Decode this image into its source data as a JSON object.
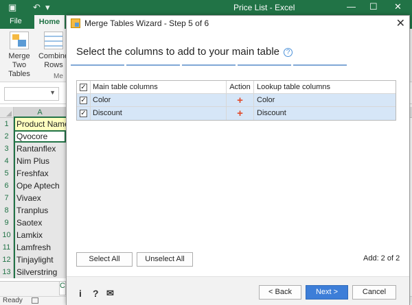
{
  "excel": {
    "window_title": "Price List - Excel",
    "qat": {
      "save_icon": "save-icon",
      "undo_icon": "undo-icon",
      "redo_icon": "redo-icon"
    },
    "tabs": {
      "file": "File",
      "home": "Home"
    },
    "ribbon": {
      "merge_label_1": "Merge",
      "merge_label_2": "Two Tables",
      "combine_label_1": "Combine",
      "combine_label_2": "Rows",
      "group_label": "Me"
    },
    "column_header": "A",
    "rows": [
      {
        "num": "1",
        "value": "Product Name"
      },
      {
        "num": "2",
        "value": "Qvocore"
      },
      {
        "num": "3",
        "value": "Rantanflex"
      },
      {
        "num": "4",
        "value": "Nim Plus"
      },
      {
        "num": "5",
        "value": "Freshfax"
      },
      {
        "num": "6",
        "value": "Ope Aptech"
      },
      {
        "num": "7",
        "value": "Vivaex"
      },
      {
        "num": "8",
        "value": "Tranplus"
      },
      {
        "num": "9",
        "value": "Saotex"
      },
      {
        "num": "10",
        "value": "Lamkix"
      },
      {
        "num": "11",
        "value": "Lamfresh"
      },
      {
        "num": "12",
        "value": "Tinjaylight"
      },
      {
        "num": "13",
        "value": "Silverstring"
      }
    ],
    "sheet_tab_glyph": "C",
    "status": "Ready"
  },
  "dialog": {
    "title": "Merge Tables Wizard - Step 5 of 6",
    "heading": "Select the columns to add to your main table",
    "help_glyph": "?",
    "steps_total": 6,
    "current_step": 5,
    "grid": {
      "header": {
        "main": "Main table columns",
        "action": "Action",
        "lookup": "Lookup table columns"
      },
      "rows": [
        {
          "main": "Color",
          "action": "+",
          "lookup": "Color",
          "checked": true
        },
        {
          "main": "Discount",
          "action": "+",
          "lookup": "Discount",
          "checked": true
        }
      ]
    },
    "select_all": "Select All",
    "unselect_all": "Unselect All",
    "add_count": "Add: 2 of 2",
    "footer": {
      "info_glyph": "i",
      "help_glyph": "?",
      "mail_glyph": "✉",
      "back": "< Back",
      "next": "Next >",
      "cancel": "Cancel"
    },
    "colors": {
      "accent": "#3d7ed8",
      "selected_row": "#d6e6f7",
      "plus": "#e04a2a",
      "excel_green": "#217346"
    }
  }
}
